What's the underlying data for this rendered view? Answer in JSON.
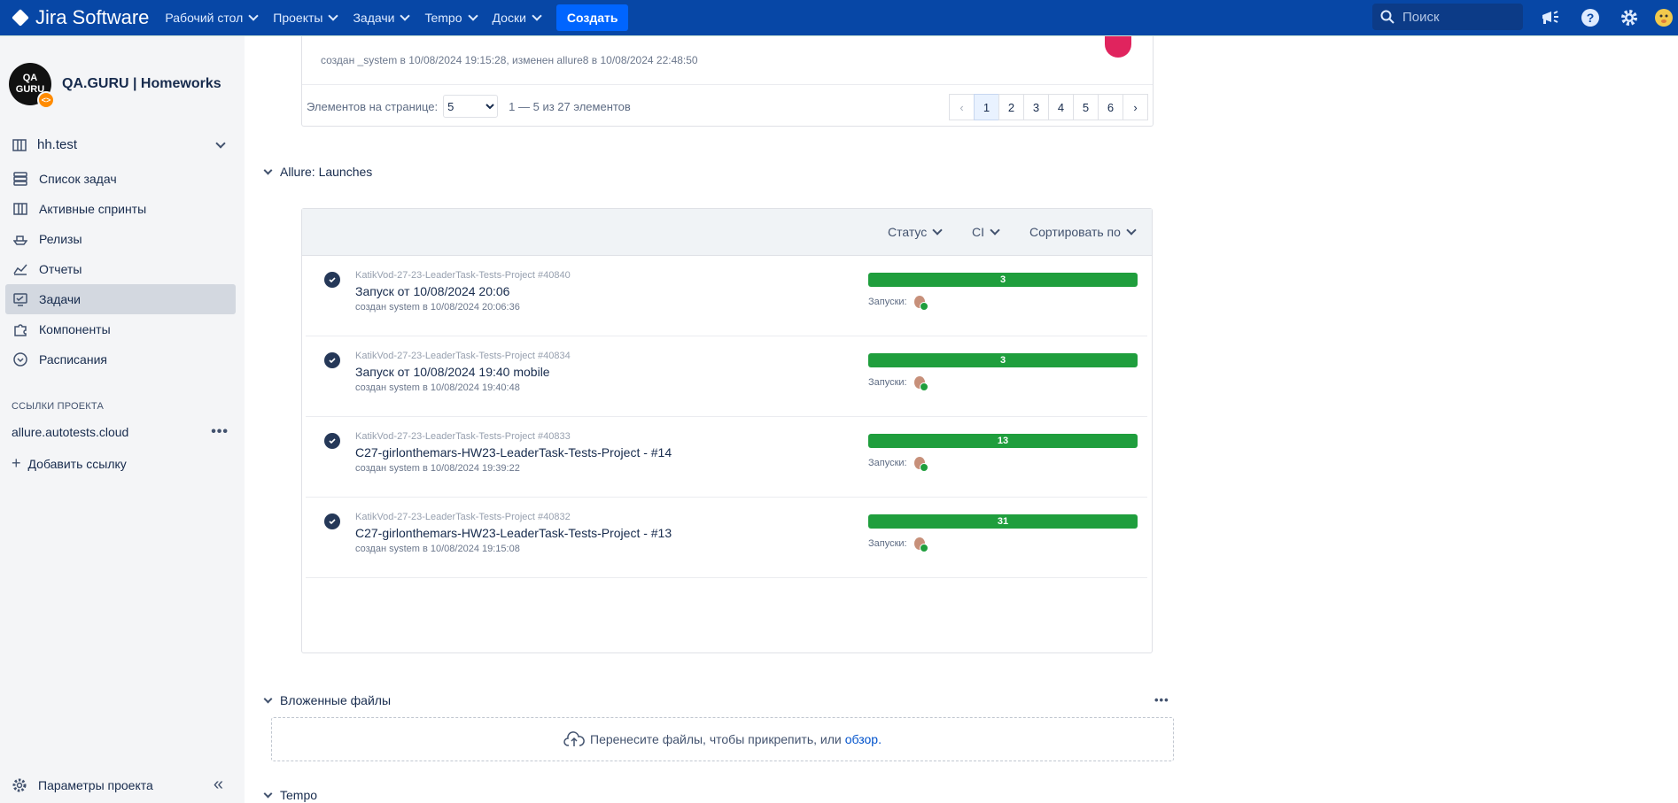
{
  "topbar": {
    "brand": "Jira Software",
    "nav": [
      "Рабочий стол",
      "Проекты",
      "Задачи",
      "Tempo",
      "Доски"
    ],
    "create": "Создать",
    "search_placeholder": "Поиск",
    "icons": [
      "megaphone-icon",
      "help-icon",
      "settings-icon",
      "avatar-icon"
    ]
  },
  "sidebar": {
    "project_name": "QA.GURU | Homeworks",
    "avatar_text": "QA GURU",
    "board": "hh.test",
    "items": [
      {
        "label": "Список задач",
        "icon": "backlog-icon"
      },
      {
        "label": "Активные спринты",
        "icon": "board-icon"
      },
      {
        "label": "Релизы",
        "icon": "ship-icon"
      },
      {
        "label": "Отчеты",
        "icon": "chart-icon"
      },
      {
        "label": "Задачи",
        "icon": "issues-icon",
        "active": true
      },
      {
        "label": "Компоненты",
        "icon": "puzzle-icon"
      },
      {
        "label": "Расписания",
        "icon": "schedule-icon"
      }
    ],
    "links_heading": "ССЫЛКИ ПРОЕКТА",
    "link": "allure.autotests.cloud",
    "add_link": "Добавить ссылку",
    "settings": "Параметры проекта"
  },
  "prev": {
    "meta": "создан _system в 10/08/2024 19:15:28, изменен allure8 в 10/08/2024 22:48:50",
    "per_page_label": "Элементов на странице:",
    "per_page_value": "5",
    "range": "1 — 5 из 27 элементов",
    "pages": [
      "1",
      "2",
      "3",
      "4",
      "5",
      "6"
    ],
    "current_page": "1"
  },
  "launches_section": {
    "title": "Allure: Launches",
    "filters": [
      "Статус",
      "CI",
      "Сортировать по"
    ],
    "runs_label": "Запуски:",
    "items": [
      {
        "project": "KatikVod-27-23-LeaderTask-Tests-Project #40840",
        "name": "Запуск от 10/08/2024 20:06",
        "created": "создан system в 10/08/2024 20:06:36",
        "count": "3"
      },
      {
        "project": "KatikVod-27-23-LeaderTask-Tests-Project #40834",
        "name": "Запуск от 10/08/2024 19:40 mobile",
        "created": "создан system в 10/08/2024 19:40:48",
        "count": "3"
      },
      {
        "project": "KatikVod-27-23-LeaderTask-Tests-Project #40833",
        "name": "C27-girlonthemars-HW23-LeaderTask-Tests-Project - #14",
        "created": "создан system в 10/08/2024 19:39:22",
        "count": "13"
      },
      {
        "project": "KatikVod-27-23-LeaderTask-Tests-Project #40832",
        "name": "C27-girlonthemars-HW23-LeaderTask-Tests-Project - #13",
        "created": "создан system в 10/08/2024 19:15:08",
        "count": "31"
      }
    ]
  },
  "attachments": {
    "title": "Вложенные файлы",
    "drop_text": "Перенесите файлы, чтобы прикрепить, или",
    "browse": "обзор."
  },
  "tempo_section": {
    "title": "Tempo"
  },
  "colors": {
    "topbar": "#0747a6",
    "create": "#0065ff",
    "success": "#1f9e3d",
    "accent_pink": "#e0245e"
  }
}
